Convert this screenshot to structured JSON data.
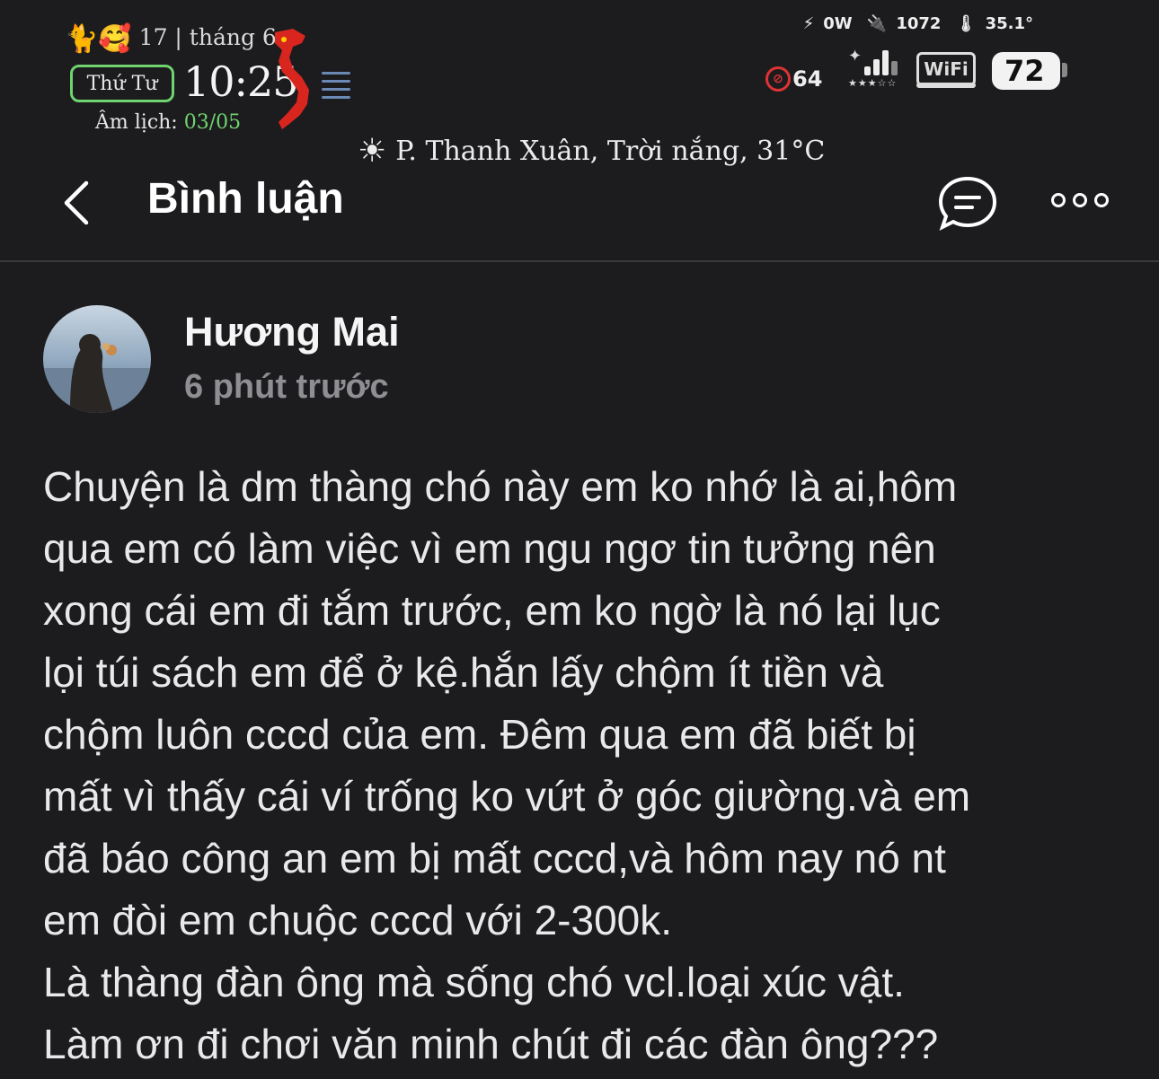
{
  "status_bar": {
    "date_text": "17 | tháng 6",
    "emojis": "🐈🥰",
    "day": "Thứ Tư",
    "time": "10:25",
    "lunar_label": "Âm lịch:",
    "lunar_date": "03/05",
    "weather": "P. Thanh Xuân, Trời nắng, 31°C",
    "power": "0W",
    "voltage": "1072",
    "temperature": "35.1°",
    "screen_count": "64",
    "wifi_label": "WiFi",
    "battery": "72"
  },
  "nav": {
    "title": "Bình luận"
  },
  "comment": {
    "author": "Hương Mai",
    "time_ago": "6 phút trước",
    "lines": [
      "Chuyện là dm thàng chó này em ko nhớ là ai,hôm",
      "qua em có làm việc vì em ngu ngơ tin tưởng nên",
      "xong cái em đi tắm trước, em ko ngờ là nó lại lục",
      "lọi túi sách em để ở kệ.hắn lấy chộm ít tiền và",
      "chộm luôn cccd của em. Đêm qua em đã biết bị",
      "mất vì thấy cái ví trống ko vứt ở góc giường.và em",
      "đã báo công an em bị mất cccd,và hôm nay nó nt",
      "em đòi em chuộc cccd với 2-300k.",
      "Là thàng đàn ông mà sống chó vcl.loại xúc vật.",
      "Làm ơn đi chơi văn minh chút đi các đàn ông???"
    ]
  }
}
